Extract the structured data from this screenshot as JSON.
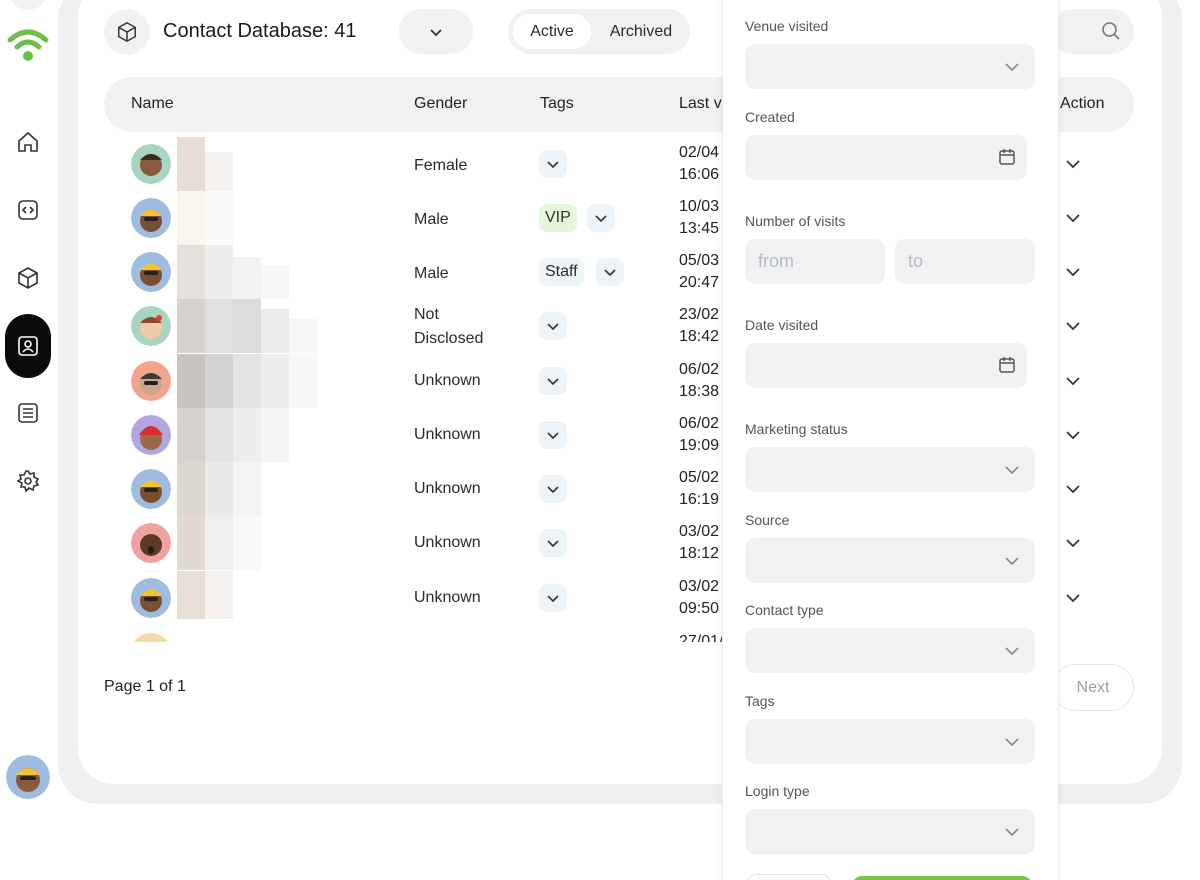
{
  "header": {
    "title": "Contact Database: 41",
    "segments": {
      "active": "Active",
      "archived": "Archived"
    }
  },
  "table": {
    "columns": {
      "name": "Name",
      "gender": "Gender",
      "tags": "Tags",
      "last_visit": "Last v",
      "action": "Action"
    },
    "rows": [
      {
        "gender": "Female",
        "tag": "",
        "date": "02/04",
        "time": "16:06",
        "avatar_bg": "#a8d5bf"
      },
      {
        "gender": "Male",
        "tag": "VIP",
        "date": "10/03",
        "time": "13:45",
        "avatar_bg": "#9dbce0"
      },
      {
        "gender": "Male",
        "tag": "Staff",
        "date": "05/03",
        "time": "20:47",
        "avatar_bg": "#9dbce0"
      },
      {
        "gender": "Not",
        "gender2": "Disclosed",
        "tag": "",
        "date": "23/02",
        "time": "18:42",
        "avatar_bg": "#a8d5bf"
      },
      {
        "gender": "Unknown",
        "tag": "",
        "date": "06/02",
        "time": "18:38",
        "avatar_bg": "#f2a58e"
      },
      {
        "gender": "Unknown",
        "tag": "",
        "date": "06/02",
        "time": "19:09",
        "avatar_bg": "#b3a6e0"
      },
      {
        "gender": "Unknown",
        "tag": "",
        "date": "05/02",
        "time": "16:19",
        "avatar_bg": "#9dbce0"
      },
      {
        "gender": "Unknown",
        "tag": "",
        "date": "03/02",
        "time": "18:12",
        "avatar_bg": "#f2a1a1"
      },
      {
        "gender": "Unknown",
        "tag": "",
        "date": "03/02",
        "time": "09:50",
        "avatar_bg": "#9dbce0"
      }
    ],
    "partial_row_date": "27/01/"
  },
  "pagination": {
    "label": "Page 1 of 1",
    "next": "Next"
  },
  "filters": {
    "venue_visited": "Venue visited",
    "created": "Created",
    "number_of_visits": "Number of visits",
    "from_placeholder": "from",
    "to_placeholder": "to",
    "date_visited": "Date visited",
    "marketing_status": "Marketing status",
    "source": "Source",
    "contact_type": "Contact type",
    "tags": "Tags",
    "login_type": "Login type"
  },
  "colors": {
    "brand_green": "#6cc04a",
    "sidebar_active": "#0b0b0b",
    "vip_bg": "#e6f6dc"
  }
}
